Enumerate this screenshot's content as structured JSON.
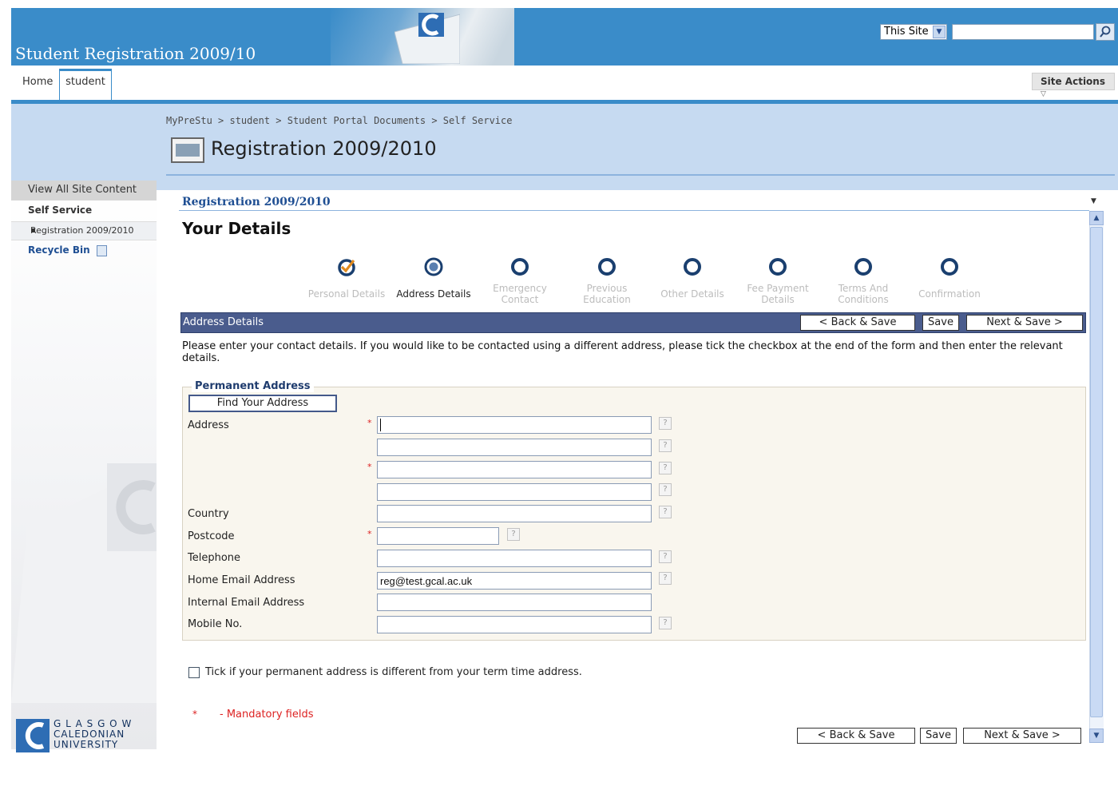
{
  "header": {
    "site_title": "Student Registration 2009/10",
    "scope_select": "This Site",
    "search_placeholder": ""
  },
  "topnav": {
    "home": "Home",
    "student": "student",
    "site_actions": "Site Actions"
  },
  "breadcrumb": "MyPreStu > student > Student Portal Documents > Self Service",
  "page_title": "Registration 2009/2010",
  "leftnav": {
    "view_all": "View All Site Content",
    "section": "Self Service",
    "item": "Registration 2009/2010",
    "recycle_bin": "Recycle Bin",
    "logo_lines": [
      "G L A S G O W",
      "CALEDONIAN",
      "UNIVERSITY"
    ]
  },
  "webpart": {
    "title": "Registration 2009/2010",
    "heading": "Your Details"
  },
  "steps": [
    {
      "line1": "Personal Details",
      "line2": "",
      "state": "done"
    },
    {
      "line1": "Address Details",
      "line2": "",
      "state": "current"
    },
    {
      "line1": "Emergency",
      "line2": "Contact",
      "state": "pending"
    },
    {
      "line1": "Previous",
      "line2": "Education",
      "state": "pending"
    },
    {
      "line1": "Other Details",
      "line2": "",
      "state": "pending"
    },
    {
      "line1": "Fee Payment",
      "line2": "Details",
      "state": "pending"
    },
    {
      "line1": "Terms And",
      "line2": "Conditions",
      "state": "pending"
    },
    {
      "line1": "Confirmation",
      "line2": "",
      "state": "pending"
    }
  ],
  "section": {
    "label": "Address Details",
    "back_save": "< Back & Save",
    "save": "Save",
    "next_save": "Next & Save >"
  },
  "intro": "Please enter your contact details. If you would like to be contacted using a different address, please tick the checkbox at the end of the form and then enter the relevant details.",
  "form": {
    "legend": "Permanent Address",
    "find_address": "Find Your Address",
    "address_label": "Address",
    "address_1": "",
    "address_2": "",
    "address_3": "",
    "address_4": "",
    "country_label": "Country",
    "country": "",
    "postcode_label": "Postcode",
    "postcode": "",
    "telephone_label": "Telephone",
    "telephone": "",
    "home_email_label": "Home Email Address",
    "home_email": "reg@test.gcal.ac.uk",
    "internal_email_label": "Internal Email Address",
    "internal_email": "",
    "mobile_label": "Mobile No.",
    "mobile": "",
    "required_marker": "*",
    "help_marker": "?"
  },
  "checkbox_label": "Tick if your permanent address is different from your term time address.",
  "mandatory": {
    "star": "*",
    "label": "- Mandatory fields"
  },
  "colors": {
    "banner": "#3a8cc9",
    "section_header": "#4a5c8d",
    "required": "#dd2222",
    "link": "#1f4f93"
  }
}
